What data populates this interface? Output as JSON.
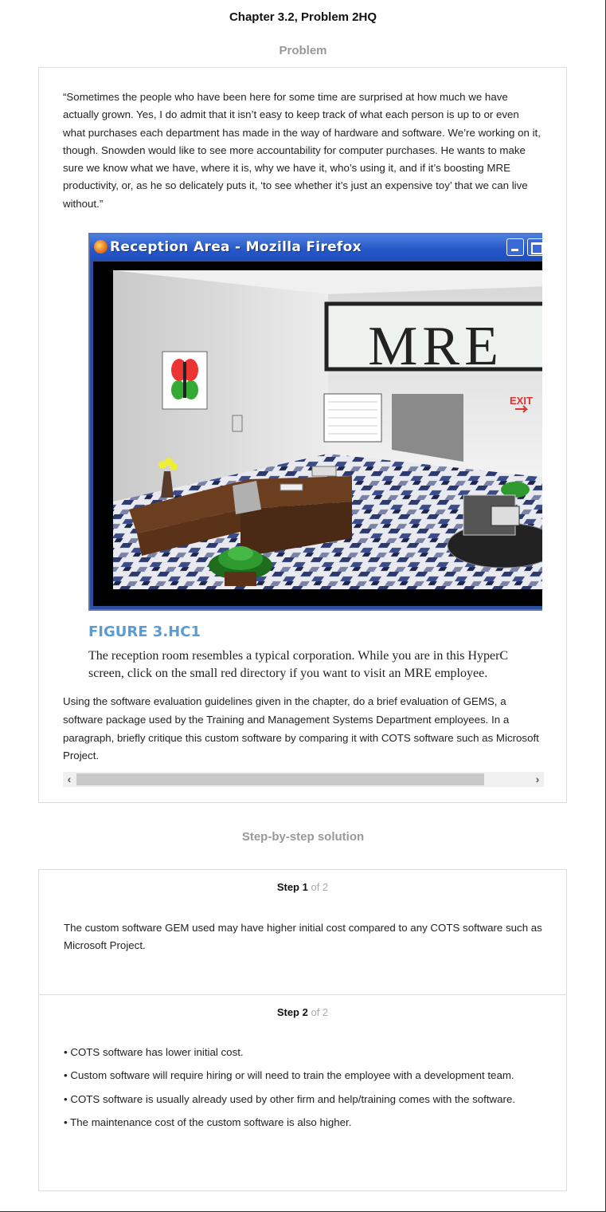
{
  "page": {
    "title": "Chapter 3.2, Problem 2HQ"
  },
  "problem": {
    "heading": "Problem",
    "quote": "“Sometimes the people who have been here for some time are surprised at how much we have actually grown. Yes, I do admit that it isn’t easy to keep track of what each person is up to or even what purchases each department has made in the way of hardware and software. We’re working on it, though. Snowden would like to see more accountability for computer purchases. He wants to make sure we know what we have, where it is, why we have it, who’s using it, and if it’s boosting MRE productivity, or, as he so delicately puts it, ‘to see whether it’s just an expensive toy’ that we can live without.”",
    "figure": {
      "window_title": "Reception Area - Mozilla Firefox",
      "sign_text": "MRE",
      "exit_text": "EXIT",
      "label": "FIGURE 3.HC1",
      "caption_line1": "The reception room resembles a typical corporation. While you are in this HyperC",
      "caption_line2": "screen, click on the small red directory if you want to visit an MRE employee."
    },
    "question": "Using the software evaluation guidelines given in the chapter, do a brief evaluation of GEMS, a software package used by the Training and Management Systems Department employees. In a paragraph, briefly critique this custom software by comparing it with COTS software such as Microsoft Project.",
    "scroll": {
      "left_arrow": "‹",
      "right_arrow": "›"
    }
  },
  "solution": {
    "heading": "Step-by-step solution",
    "steps": [
      {
        "label": "Step 1",
        "of": "of 2",
        "text": "The custom software GEM used may have higher initial cost compared to any COTS software such as Microsoft Project."
      },
      {
        "label": "Step 2",
        "of": "of 2",
        "bullets": [
          "• COTS software has lower initial cost.",
          "• Custom software will require hiring or will need to train the employee with a development team.",
          "• COTS software is usually already used by other firm and help/training comes with the software.",
          "• The maintenance cost of the custom software is also higher."
        ]
      }
    ]
  }
}
